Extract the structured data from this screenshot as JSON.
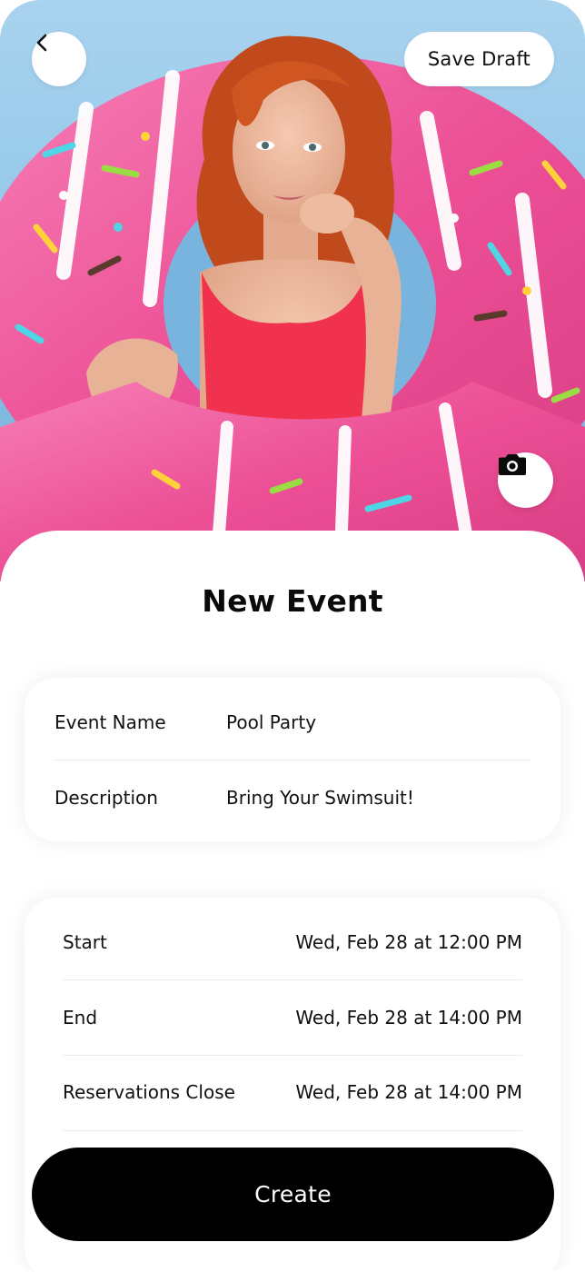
{
  "header": {
    "back_icon": "chevron-left-icon",
    "save_draft_label": "Save Draft",
    "camera_icon": "camera-icon"
  },
  "hero": {
    "subject": "woman-with-pink-donut-pool-float",
    "colors": {
      "background": "#8cc3e6",
      "float_pink": "#f0559b",
      "hair": "#c8501f",
      "swimsuit": "#f0324e"
    }
  },
  "form": {
    "title": "New Event",
    "details": [
      {
        "label": "Event Name",
        "value": "Pool Party"
      },
      {
        "label": "Description",
        "value": "Bring Your Swimsuit!"
      }
    ],
    "times": [
      {
        "label": "Start",
        "value": "Wed, Feb 28 at 12:00 PM"
      },
      {
        "label": "End",
        "value": "Wed, Feb 28 at 14:00 PM"
      },
      {
        "label": "Reservations Close",
        "value": "Wed, Feb 28 at 14:00 PM"
      }
    ]
  },
  "actions": {
    "create_label": "Create"
  },
  "colors": {
    "primary_button": "#000000",
    "surface": "#ffffff",
    "divider": "#ebebeb"
  }
}
